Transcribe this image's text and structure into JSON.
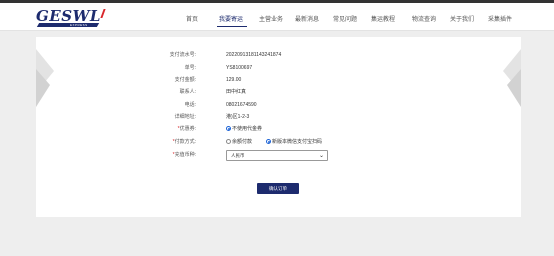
{
  "header": {
    "logo_text": "GESWL",
    "logo_sub": "EXPRESS",
    "nav": [
      {
        "label": "首页"
      },
      {
        "label": "我要寄运"
      },
      {
        "label": "主营业务"
      },
      {
        "label": "最新消息"
      },
      {
        "label": "常见问题"
      },
      {
        "label": "集运教程"
      },
      {
        "label": "物流查询"
      },
      {
        "label": "关于我们"
      },
      {
        "label": "采集插件"
      }
    ],
    "active_index": 1
  },
  "form": {
    "serial_label": "支付流水号:",
    "serial_value": "20220913181143241874",
    "order_label": "单号:",
    "order_value": "YS8100697",
    "amount_label": "支付金额:",
    "amount_value": "129.00",
    "contact_label": "联系人:",
    "contact_value": "田中红真",
    "phone_label": "电话:",
    "phone_value": "08021674590",
    "address_label": "详细地址:",
    "address_value": "港)区1-2-3",
    "coupon_label": "优惠券:",
    "coupon_option": "不使用代金券",
    "pay_label": "付款方式:",
    "pay_options": [
      {
        "label": "余额付款",
        "selected": false
      },
      {
        "label": "新版本微信支付宝扫码",
        "selected": true
      }
    ],
    "currency_label": "充值币种:",
    "currency_value": "人民币",
    "confirm_label": "确认订单"
  },
  "colors": {
    "brand": "#1d2b6e",
    "accent_red": "#d9262b",
    "radio_blue": "#1d63d6"
  }
}
